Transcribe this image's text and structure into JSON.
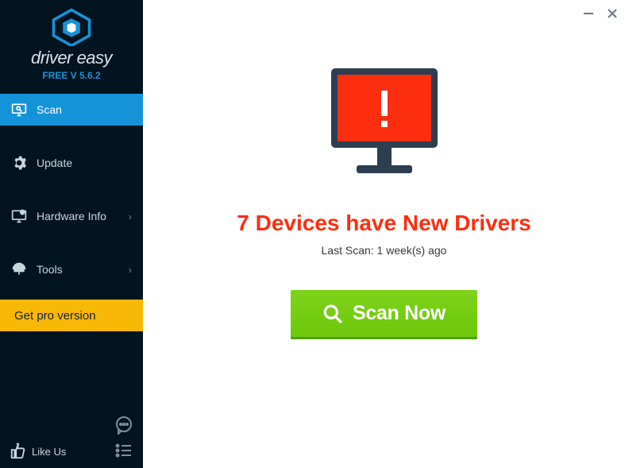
{
  "app": {
    "name": "driver easy",
    "version_label": "FREE V 5.6.2"
  },
  "sidebar": {
    "items": [
      {
        "label": "Scan",
        "has_submenu": false,
        "active": true
      },
      {
        "label": "Update",
        "has_submenu": false,
        "active": false
      },
      {
        "label": "Hardware Info",
        "has_submenu": true,
        "active": false
      },
      {
        "label": "Tools",
        "has_submenu": true,
        "active": false
      }
    ],
    "pro_button": "Get pro version",
    "like_us": "Like Us"
  },
  "main": {
    "alert_heading": "7 Devices have New Drivers",
    "last_scan": "Last Scan: 1 week(s) ago",
    "scan_button": "Scan Now"
  },
  "colors": {
    "accent": "#1593d8",
    "alert": "#fd2e0f",
    "cta": "#6ec70d",
    "pro": "#f8b806"
  }
}
